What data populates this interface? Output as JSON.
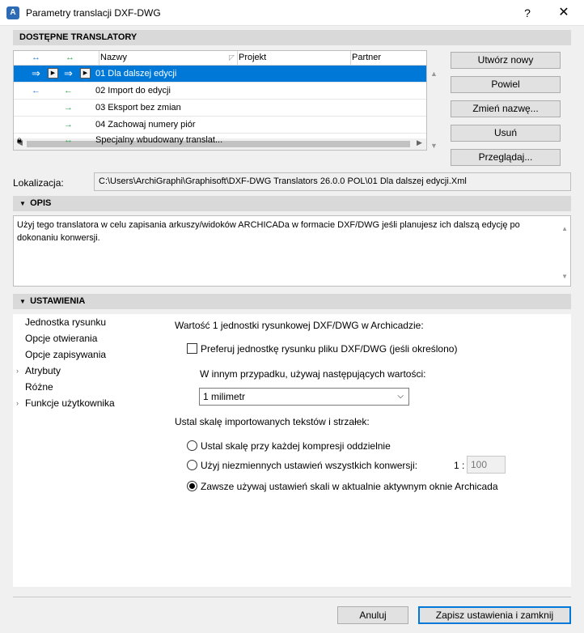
{
  "window": {
    "title": "Parametry translacji DXF-DWG",
    "help": "?",
    "close": "✕"
  },
  "sections": {
    "translators": "DOSTĘPNE TRANSLATORY",
    "description": "OPIS",
    "settings": "USTAWIENIA"
  },
  "table": {
    "headers": {
      "open": "↔",
      "save": "↔",
      "name": "Nazwy",
      "project": "Projekt",
      "partner": "Partner"
    },
    "rows": [
      {
        "open": "⇒",
        "save": "⇒",
        "name": "01 Dla dalszej edycji",
        "selected": true
      },
      {
        "open": "←",
        "save": "←",
        "name": "02 Import do edycji"
      },
      {
        "open": "",
        "save": "→",
        "name": "03 Eksport bez zmian"
      },
      {
        "open": "",
        "save": "→",
        "name": "04 Zachowaj numery piór"
      },
      {
        "open": "",
        "save": "↔",
        "name": "Specjalny wbudowany translat..."
      }
    ]
  },
  "buttons": {
    "create": "Utwórz nowy",
    "duplicate": "Powiel",
    "rename": "Zmień nazwę...",
    "delete": "Usuń",
    "browse": "Przeglądaj...",
    "cancel": "Anuluj",
    "save_close": "Zapisz ustawienia i zamknij"
  },
  "location": {
    "label": "Lokalizacja:",
    "path": "C:\\Users\\ArchiGraphi\\Graphisoft\\DXF-DWG Translators 26.0.0 POL\\01 Dla dalszej edycji.Xml"
  },
  "description": {
    "text": "Użyj tego translatora w celu zapisania arkuszy/widoków ARCHICADa w formacie DXF/DWG jeśli planujesz ich dalszą edycję po dokonaniu konwersji."
  },
  "nav": [
    {
      "label": "Jednostka rysunku",
      "expandable": false
    },
    {
      "label": "Opcje otwierania",
      "expandable": false
    },
    {
      "label": "Opcje zapisywania",
      "expandable": false
    },
    {
      "label": "Atrybuty",
      "expandable": true
    },
    {
      "label": "Różne",
      "expandable": false
    },
    {
      "label": "Funkcje użytkownika",
      "expandable": true
    }
  ],
  "unit": {
    "heading": "Wartość 1 jednostki rysunkowej DXF/DWG w Archicadzie:",
    "prefer_label": "Preferuj jednostkę rysunku pliku DXF/DWG (jeśli określono)",
    "prefer_checked": false,
    "otherwise_label": "W innym przypadku, używaj następujących wartości:",
    "unit_value": "1 milimetr",
    "scale_heading": "Ustal skalę importowanych tekstów i strzałek:",
    "radio_each": "Ustal skalę przy każdej kompresji oddzielnie",
    "radio_fixed": "Użyj niezmiennych ustawień wszystkich konwersji:",
    "ratio_prefix": "1 :",
    "ratio_value": "100",
    "radio_active": "Zawsze używaj ustawień skali w aktualnie aktywnym oknie Archicada",
    "selected_radio": "radio_active"
  }
}
